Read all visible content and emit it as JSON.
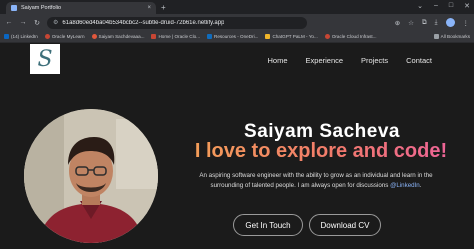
{
  "browser": {
    "tab_title": "Saiyam Portfolio",
    "tab_close": "×",
    "new_tab": "+",
    "window_controls": [
      "⌄",
      "–",
      "□",
      "✕"
    ],
    "nav_buttons": [
      "←",
      "→",
      "↻"
    ],
    "url": "61a8d60ed4ba04b534bcbc2--subtle-druid-72b61e.netlify.app",
    "url_icon": "⚙",
    "bookmarks": [
      {
        "label": "(14) LinkedIn",
        "color": "#0a66c2"
      },
      {
        "label": "Oracle MyLearn",
        "color": "#c74634"
      },
      {
        "label": "Saiyam Sachdevaaa...",
        "color": "#e0573c"
      },
      {
        "label": "Home | Oracle Clo...",
        "color": "#c74634"
      },
      {
        "label": "Resources - OneDri...",
        "color": "#0f6cbd"
      },
      {
        "label": "ChatGPT PaLM - Yo...",
        "color": "#f1b62a"
      },
      {
        "label": "Oracle Cloud Infrast...",
        "color": "#c74634"
      }
    ],
    "all_bookmarks": "All Bookmarks"
  },
  "site": {
    "logo_letter": "S",
    "nav": [
      "Home",
      "Experience",
      "Projects",
      "Contact"
    ],
    "name": "Saiyam Sacheva",
    "tagline": "I love to explore and code!",
    "bio_line1": "An aspiring software engineer with the ability to grow as an individual and learn in the",
    "bio_line2": "surrounding of talented people. I am always open for discussions ",
    "bio_link": "@LinkedIn",
    "bio_end": ".",
    "btn_primary": "Get In Touch",
    "btn_secondary": "Download CV"
  }
}
